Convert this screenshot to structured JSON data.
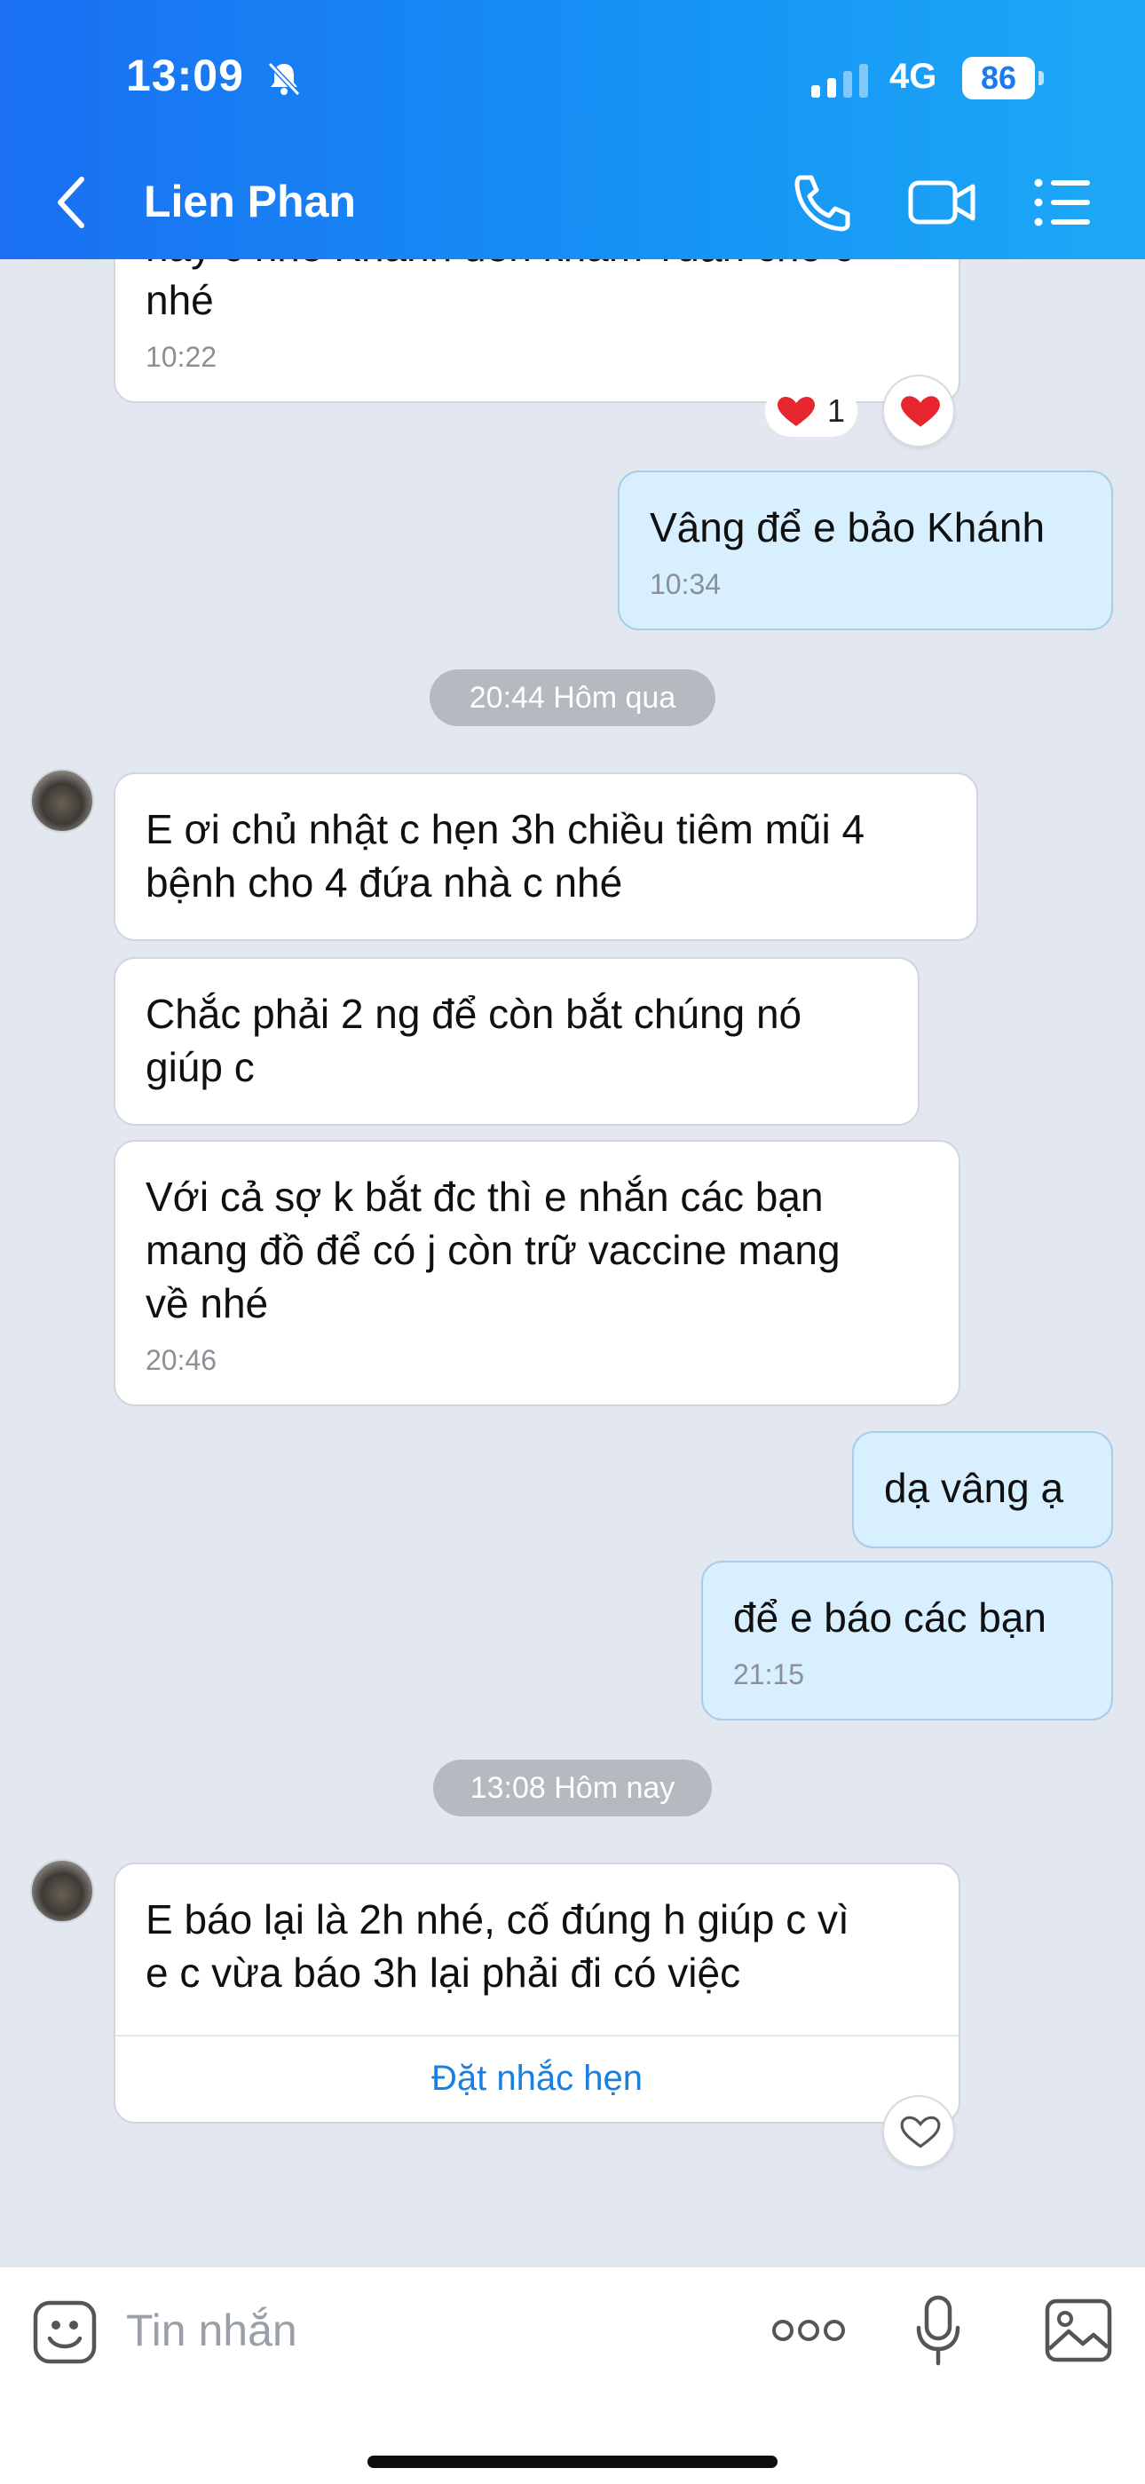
{
  "status": {
    "time": "13:09",
    "network": "4G",
    "battery": "86"
  },
  "header": {
    "name": "Lien Phan"
  },
  "messages": {
    "m0_text": "này c nhé Khánh đến khám Tuấn cho c",
    "m0_text2": "nhé",
    "m0_time": "10:22",
    "m0_reaction_count": "1",
    "m1_text": "Vâng để e bảo Khánh",
    "m1_time": "10:34",
    "sep1": "20:44 Hôm qua",
    "m2_line1": "E ơi chủ nhật c hẹn 3h chiều tiêm mũi 4",
    "m2_line2": "bệnh cho 4 đứa nhà c nhé",
    "m3_line1": "Chắc phải 2 ng để còn bắt chúng nó",
    "m3_line2": "giúp c",
    "m4_line1": "Với cả sợ k bắt đc thì e nhắn các bạn",
    "m4_line2": "mang đồ để có j còn trữ vaccine mang",
    "m4_line3": "về nhé",
    "m4_time": "20:46",
    "m5_text": "dạ vâng ạ",
    "m6_text": "để e báo các bạn",
    "m6_time": "21:15",
    "sep2": "13:08 Hôm nay",
    "m7_line1": "E báo lại là 2h nhé, cố đúng h giúp c vì",
    "m7_line2": "e c vừa báo 3h lại phải đi có việc",
    "m7_action": "Đặt nhắc hẹn"
  },
  "input": {
    "placeholder": "Tin nhắn"
  },
  "icons": [
    "bell-muted-icon",
    "signal-icon",
    "back-arrow-icon",
    "phone-icon",
    "video-icon",
    "menu-list-icon",
    "heart-icon",
    "emoji-icon",
    "more-icon",
    "mic-icon",
    "image-icon"
  ],
  "colors": {
    "header": "#1a6ff2",
    "bubble_me": "#d7efff",
    "link": "#1a7fe0",
    "heart": "#e8262e"
  }
}
